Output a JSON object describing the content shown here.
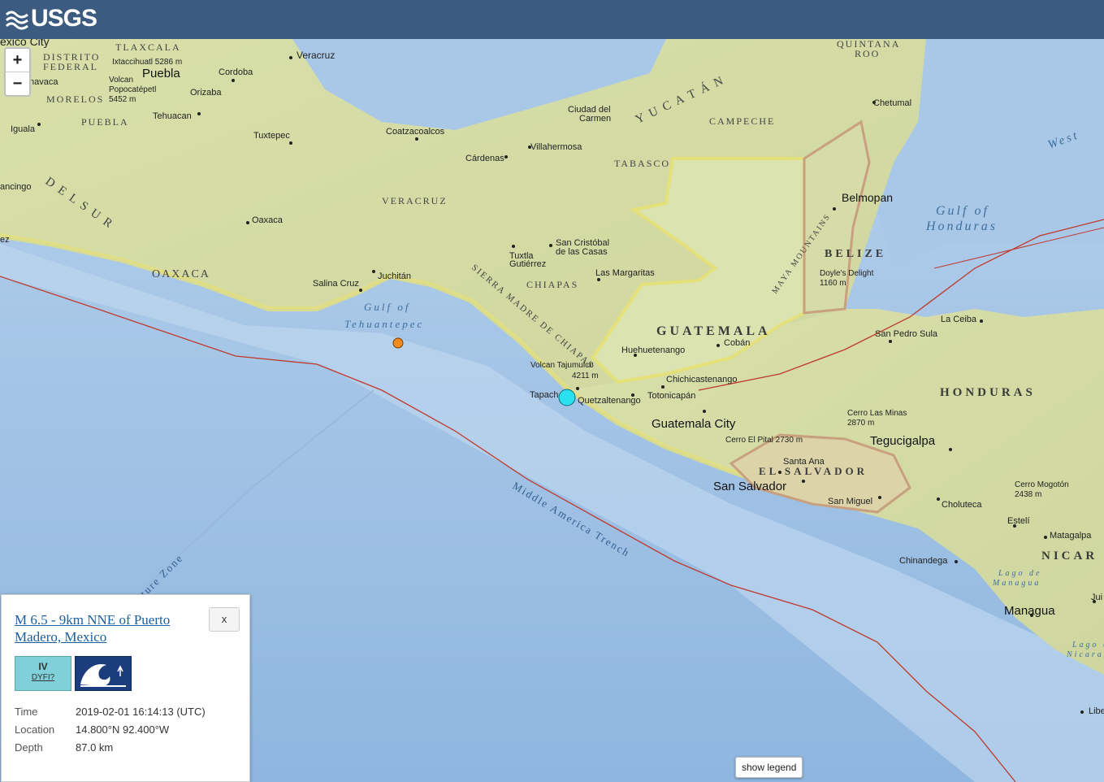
{
  "header": {
    "logo_text": "USGS"
  },
  "zoom": {
    "in_label": "+",
    "out_label": "−"
  },
  "map": {
    "colors": {
      "ocean": "#a9c8e8",
      "land": "#d9e0b0",
      "trench": "#c0392b",
      "highlight_border": "#e4e07a"
    },
    "labels": {
      "mexico_city": "exico City",
      "tlaxcala": "TLAXCALA",
      "distrito": "DISTRITO",
      "federal": "FEDERAL",
      "iztaccihuatl": "Ixtaccihuatl 5286 m",
      "veracruz_city": "Veracruz",
      "puebla_city": "Puebla",
      "cordoba": "Cordoba",
      "orizaba": "Orizaba",
      "volcan_popo_1": "Volcan",
      "volcan_popo_2": "Popocatépetl",
      "volcan_popo_3": "5452 m",
      "navaca": "navaca",
      "morelos": "MORELOS",
      "puebla_state": "PUEBLA",
      "tehuacan": "Tehuacan",
      "iguala": "Iguala",
      "tuxtepec": "Tuxtepec",
      "coatzacoalcos": "Coatzacoalcos",
      "cardenas": "Cárdenas",
      "villahermosa": "Villahermosa",
      "ciudad_carmen_1": "Ciudad del",
      "ciudad_carmen_2": "Carmen",
      "yucatan": "Y U C A T Á N",
      "campeche": "CAMPECHE",
      "quintana_1": "QUINTANA",
      "quintana_2": "ROO",
      "chetumal": "Chetumal",
      "tabasco": "TABASCO",
      "west": "West",
      "belmopan": "Belmopan",
      "gulf_honduras_1": "Gulf of",
      "gulf_honduras_2": "Honduras",
      "belize": "BELIZE",
      "maya_mountains": "MAYA MOUNTAINS",
      "doyles_1": "Doyle's Delight",
      "doyles_2": "1160 m",
      "ancingo": "ancingo",
      "del_sur": "D E L   S U R",
      "oaxaca_city": "Oaxaca",
      "veracruz_state": "VERACRUZ",
      "oaxaca_state": "OAXACA",
      "juchitan": "Juchitán",
      "salina_cruz": "Salina Cruz",
      "tuxtla_1": "Tuxtla",
      "tuxtla_2": "Gutiérrez",
      "san_cristobal_1": "San Cristóbal",
      "san_cristobal_2": "de las Casas",
      "las_margaritas": "Las Margaritas",
      "chiapas": "CHIAPAS",
      "sierra_madre": "SIERRA MADRE DE CHIAPAS",
      "gulf_tehuantepec_1": "Gulf of",
      "gulf_tehuantepec_2": "Tehuantepec",
      "guatemala_country": "GUATEMALA",
      "huehuetenango": "Huehuetenango",
      "coban": "Cobán",
      "volcan_tajumulco_1": "Volcan Tajumulco",
      "volcan_tajumulco_2": "4211 m",
      "chichicastenango": "Chichicastenango",
      "tapachula": "Tapach",
      "quetzaltenango": "Quetzaltenango",
      "totonicapan": "Totonicapán",
      "guatemala_city": "Guatemala City",
      "cerro_pital": "Cerro El Pital 2730 m",
      "santa_ana": "Santa Ana",
      "el_salvador": "EL SALVADOR",
      "san_salvador": "San Salvador",
      "san_miguel": "San Miguel",
      "la_ceiba": "La Ceiba",
      "san_pedro_sula": "San Pedro Sula",
      "honduras": "HONDURAS",
      "cerro_minas_1": "Cerro Las Minas",
      "cerro_minas_2": "2870 m",
      "tegucigalpa": "Tegucigalpa",
      "cerro_mogoton_1": "Cerro Mogotón",
      "cerro_mogoton_2": "2438 m",
      "choluteca": "Choluteca",
      "esteli": "Estelí",
      "matagalpa": "Matagalpa",
      "chinandega": "Chinandega",
      "nicaragua": "NICAR",
      "lago_managua_1": "Lago de",
      "lago_managua_2": "Managua",
      "managua": "Managua",
      "lago_nicaragua_1": "Lago de",
      "lago_nicaragua_2": "Nicarag",
      "jui": "Jui",
      "libe": "Libe",
      "middle_america_trench": "Middle America Trench",
      "fracture_zone": "ture Zone",
      "ez": "ez"
    }
  },
  "popup": {
    "title": "M 6.5 - 9km NNE of Puerto Madero, Mexico",
    "close_label": "x",
    "dyfi_level": "IV",
    "dyfi_label": "DYFI?",
    "tsunami_icon": "tsunami-wave-icon",
    "rows": [
      {
        "label": "Time",
        "value": "2019-02-01 16:14:13 (UTC)"
      },
      {
        "label": "Location",
        "value": "14.800°N 92.400°W"
      },
      {
        "label": "Depth",
        "value": "87.0 km"
      }
    ]
  },
  "legend_button": "show legend"
}
